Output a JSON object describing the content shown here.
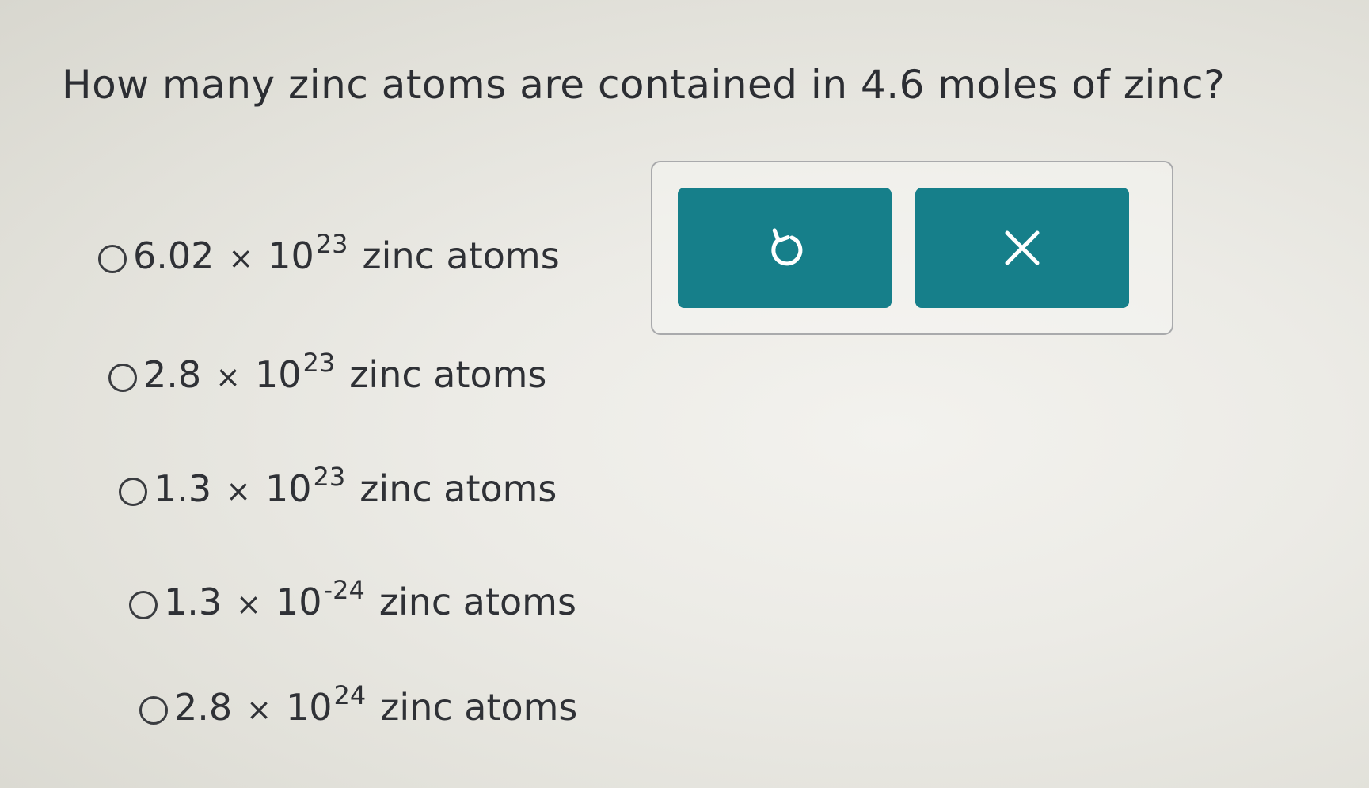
{
  "question": {
    "text": "How many zinc atoms are contained in 4.6 moles of zinc?"
  },
  "options": [
    {
      "coefficient": "6.02",
      "times": "×",
      "base": "10",
      "exponent": "23",
      "unit": "zinc atoms"
    },
    {
      "coefficient": "2.8",
      "times": "×",
      "base": "10",
      "exponent": "23",
      "unit": "zinc atoms"
    },
    {
      "coefficient": "1.3",
      "times": "×",
      "base": "10",
      "exponent": "23",
      "unit": "zinc atoms"
    },
    {
      "coefficient": "1.3",
      "times": "×",
      "base": "10",
      "exponent": "-24",
      "unit": "zinc atoms"
    },
    {
      "coefficient": "2.8",
      "times": "×",
      "base": "10",
      "exponent": "24",
      "unit": "zinc atoms"
    }
  ],
  "toolbar": {
    "undo_icon": "undo-icon",
    "clear_icon": "x-icon",
    "button_color": "#167f8a"
  }
}
